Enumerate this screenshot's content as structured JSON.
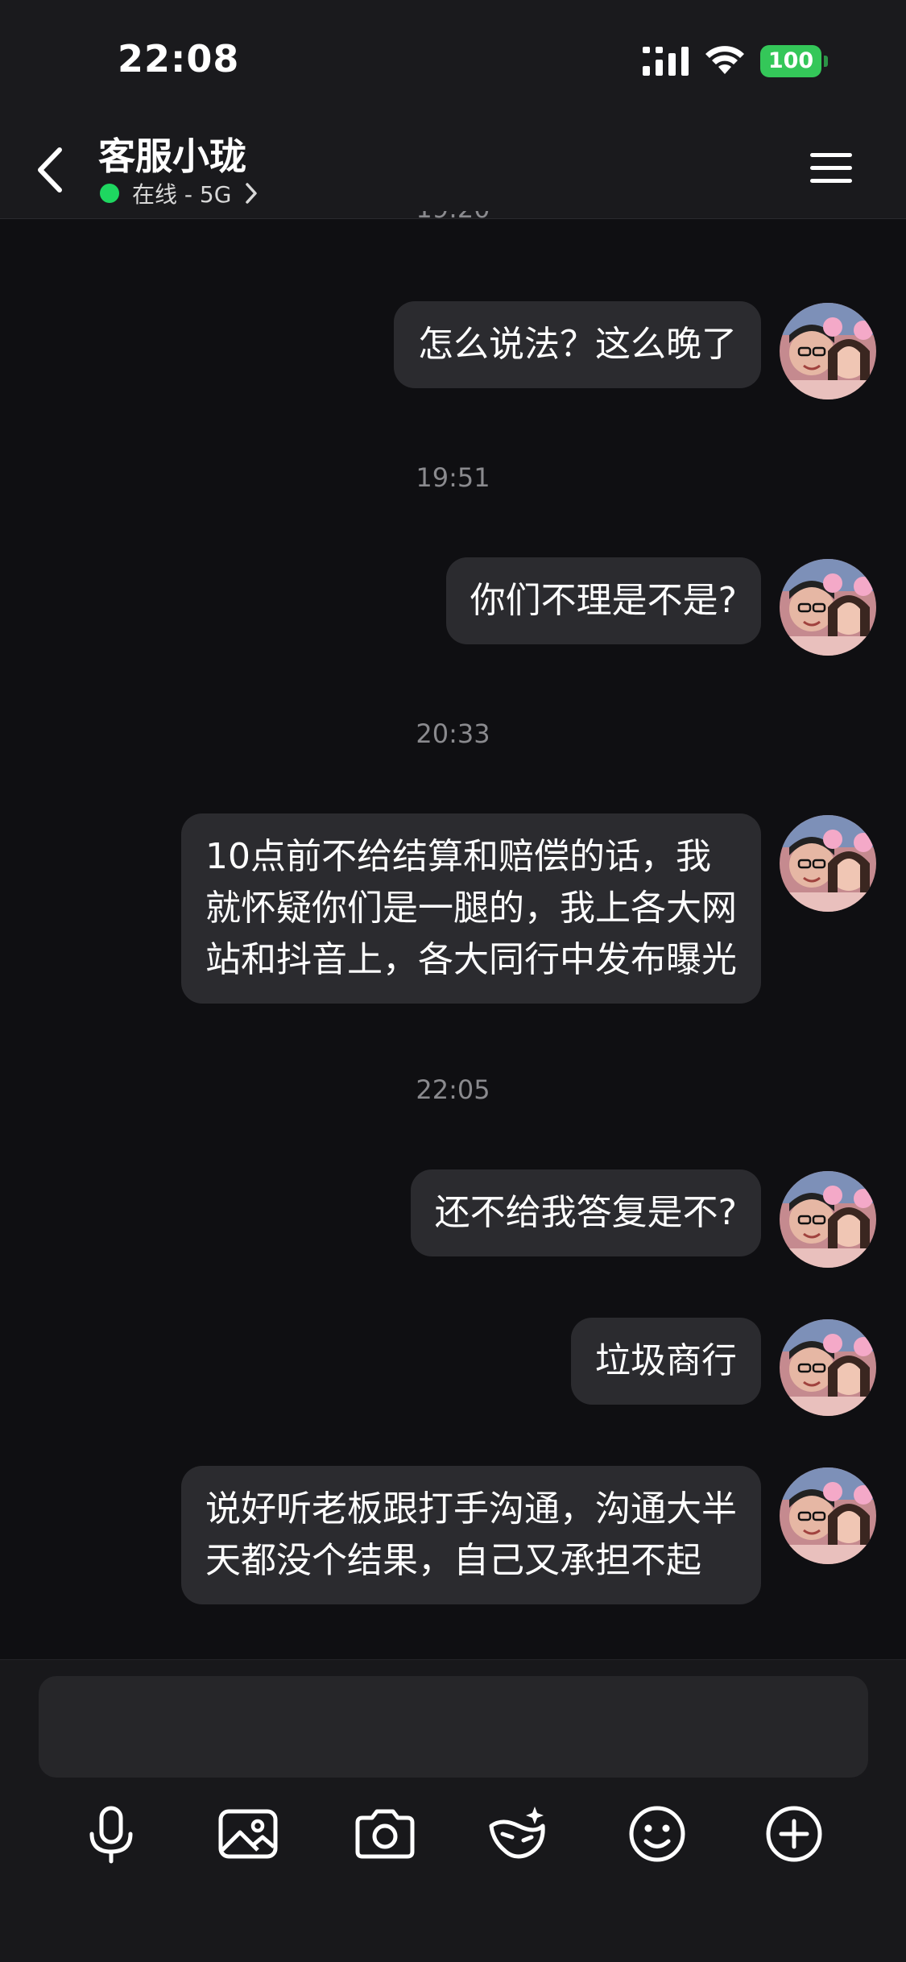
{
  "status_bar": {
    "time": "22:08",
    "battery": "100",
    "battery_color": "#34c759"
  },
  "header": {
    "contact_name": "客服小珑",
    "status_text": "在线 - 5G",
    "online_color": "#1ed760",
    "icons": [
      "back-arrow-icon",
      "menu-icon",
      "chevron-right-icon"
    ]
  },
  "messages": {
    "partial_timestamp": "19:20",
    "items": [
      {
        "type": "timestamp",
        "text": "19:51"
      },
      {
        "type": "timestamp",
        "text": "20:33"
      },
      {
        "type": "timestamp",
        "text": "22:05"
      }
    ],
    "bubbles": [
      {
        "lines": [
          "怎么说法？这么晚了"
        ]
      },
      {
        "lines": [
          "你们不理是不是?"
        ]
      },
      {
        "lines": [
          "10点前不给结算和赔偿的话，我",
          "就怀疑你们是一腿的，我上各大网",
          "站和抖音上，各大同行中发布曝光"
        ]
      },
      {
        "lines": [
          "还不给我答复是不?"
        ]
      },
      {
        "lines": [
          "垃圾商行"
        ]
      },
      {
        "lines": [
          "说好听老板跟打手沟通，沟通大半",
          "天都没个结果，自己又承担不起"
        ]
      }
    ],
    "bubble_color": "#2b2b2f"
  },
  "composer": {
    "tools": [
      "microphone-icon",
      "image-icon",
      "camera-icon",
      "ai-mask-icon",
      "emoji-icon",
      "plus-icon"
    ]
  }
}
